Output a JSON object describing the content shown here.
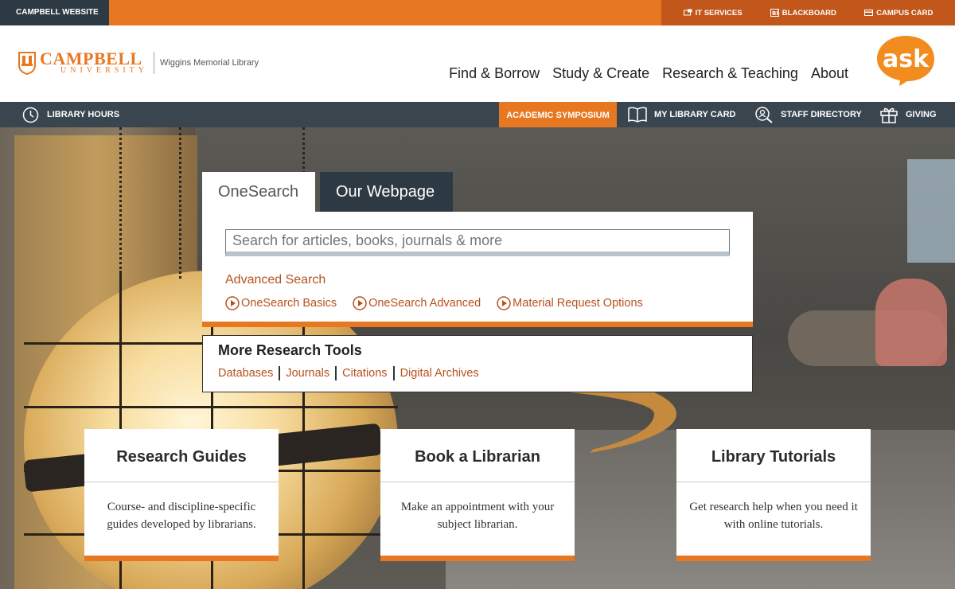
{
  "topbar": {
    "site_link": "CAMPBELL WEBSITE",
    "links": [
      {
        "label": "IT SERVICES",
        "icon": "it-services-icon"
      },
      {
        "label": "BLACKBOARD",
        "icon": "blackboard-icon"
      },
      {
        "label": "CAMPUS CARD",
        "icon": "campus-card-icon"
      }
    ]
  },
  "header": {
    "logo_top": "CAMPBELL",
    "logo_bottom": "UNIVERSITY",
    "library_name": "Wiggins Memorial Library",
    "nav": [
      "Find & Borrow",
      "Study & Create",
      "Research & Teaching",
      "About"
    ],
    "ask_label": "ask"
  },
  "darkbar": {
    "hours": "LIBRARY HOURS",
    "symposium": "ACADEMIC SYMPOSIUM",
    "library_card": "MY LIBRARY CARD",
    "staff_directory": "STAFF DIRECTORY",
    "giving": "GIVING"
  },
  "search": {
    "tabs": [
      "OneSearch",
      "Our Webpage"
    ],
    "placeholder": "Search for articles, books, journals & more",
    "advanced": "Advanced Search",
    "quick_links": [
      "OneSearch Basics",
      "OneSearch Advanced",
      "Material Request Options"
    ]
  },
  "tools": {
    "title": "More Research Tools",
    "links": [
      "Databases",
      "Journals",
      "Citations",
      "Digital Archives"
    ]
  },
  "cards": [
    {
      "title": "Research Guides",
      "desc": "Course- and discipline-specific guides developed by librarians."
    },
    {
      "title": "Book a Librarian",
      "desc": "Make an appointment with your subject librarian."
    },
    {
      "title": "Library Tutorials",
      "desc": "Get research help when you need it with online tutorials."
    }
  ],
  "colors": {
    "accent": "#e87722",
    "dark": "#2d3a44",
    "link": "#b5521e"
  }
}
